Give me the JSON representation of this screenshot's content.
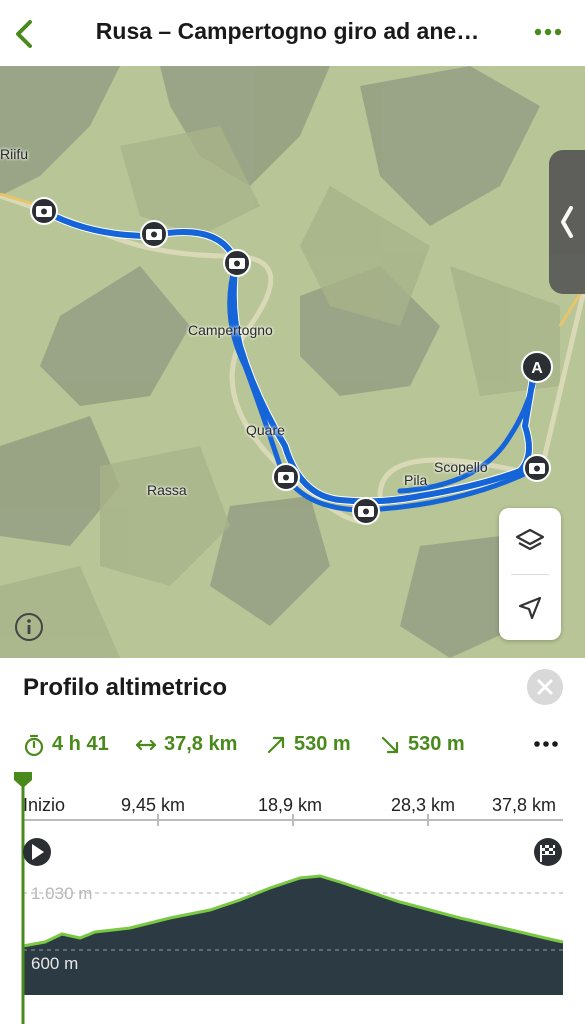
{
  "header": {
    "title": "Rusa – Campertogno giro ad ane…"
  },
  "map": {
    "places": {
      "riifu": "Riifu",
      "campertogno": "Campertogno",
      "quare": "Quare",
      "rassa": "Rassa",
      "pila": "Pila",
      "scopello": "Scopello"
    },
    "start_marker": "A"
  },
  "profile": {
    "title": "Profilo altimetrico",
    "stats": {
      "duration": "4 h 41",
      "distance": "37,8 km",
      "ascent": "530 m",
      "descent": "530 m"
    },
    "x_ticks": [
      "Inizio",
      "9,45 km",
      "18,9 km",
      "28,3 km",
      "37,8 km"
    ],
    "y_labels": {
      "upper": "1.030 m",
      "lower": "600 m"
    },
    "colors": {
      "accent": "#4a8a1c",
      "route": "#1565d8",
      "profile_fill": "#2c3a44",
      "profile_line": "#7ac943"
    }
  },
  "icons": [
    "chevron-left-icon",
    "more-horizontal-icon",
    "camera-icon",
    "layers-icon",
    "locate-arrow-icon",
    "info-icon",
    "close-icon",
    "stopwatch-icon",
    "distance-arrows-icon",
    "ascent-arrow-icon",
    "descent-arrow-icon",
    "play-icon",
    "finish-flag-icon"
  ]
}
